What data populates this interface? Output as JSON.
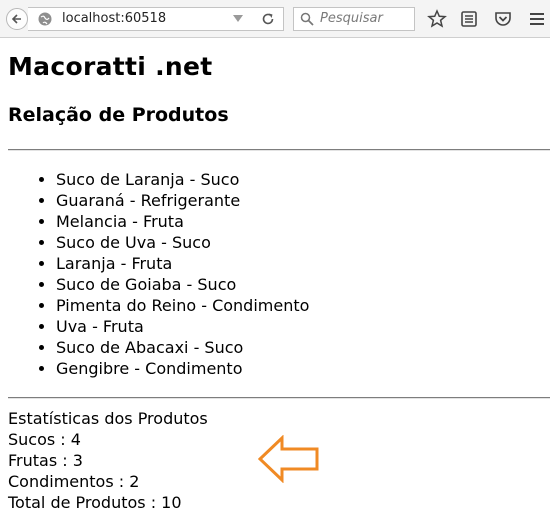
{
  "browser": {
    "url": "localhost:60518",
    "search_placeholder": "Pesquisar"
  },
  "page": {
    "title": "Macoratti .net",
    "subtitle": "Relação de Produtos",
    "products": [
      "Suco de Laranja - Suco",
      "Guaraná - Refrigerante",
      "Melancia - Fruta",
      "Suco de Uva - Suco",
      "Laranja - Fruta",
      "Suco de Goiaba - Suco",
      "Pimenta do Reino - Condimento",
      "Uva - Fruta",
      "Suco de Abacaxi - Suco",
      "Gengibre - Condimento"
    ],
    "stats": {
      "heading": "Estatísticas dos Produtos",
      "sucos": "Sucos : 4",
      "frutas": "Frutas : 3",
      "condimentos": "Condimentos : 2",
      "total": "Total de Produtos : 10"
    }
  },
  "colors": {
    "arrow": "#f08a24"
  }
}
